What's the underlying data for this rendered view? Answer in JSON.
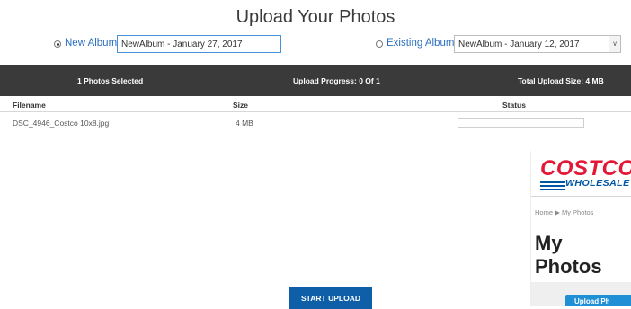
{
  "page": {
    "title": "Upload Your Photos"
  },
  "album": {
    "new_label": "New Album",
    "new_value": "NewAlbum - January 27, 2017",
    "existing_label": "Existing Album",
    "existing_selected": "NewAlbum - January 12, 2017",
    "selected_option": "new"
  },
  "upload_bar": {
    "selected": "1 Photos Selected",
    "progress": "Upload Progress: 0 Of 1",
    "total_size": "Total Upload Size: 4 MB",
    "bg_color": "#3a3a3a"
  },
  "table": {
    "headers": {
      "filename": "Filename",
      "size": "Size",
      "status": "Status"
    },
    "rows": [
      {
        "filename": "DSC_4946_Costco 10x8.jpg",
        "size": "4 MB",
        "status_progress": 0
      }
    ]
  },
  "start_button": {
    "label": "START UPLOAD",
    "color": "#0f5fa8"
  },
  "costco_panel": {
    "logo_text": "COSTCO",
    "logo_sub": "WHOLESALE",
    "breadcrumb": "Home ▶ My Photos",
    "heading": "My Photos",
    "upload_button": "Upload Ph",
    "brand_red": "#e31837",
    "brand_blue": "#0055a5"
  }
}
